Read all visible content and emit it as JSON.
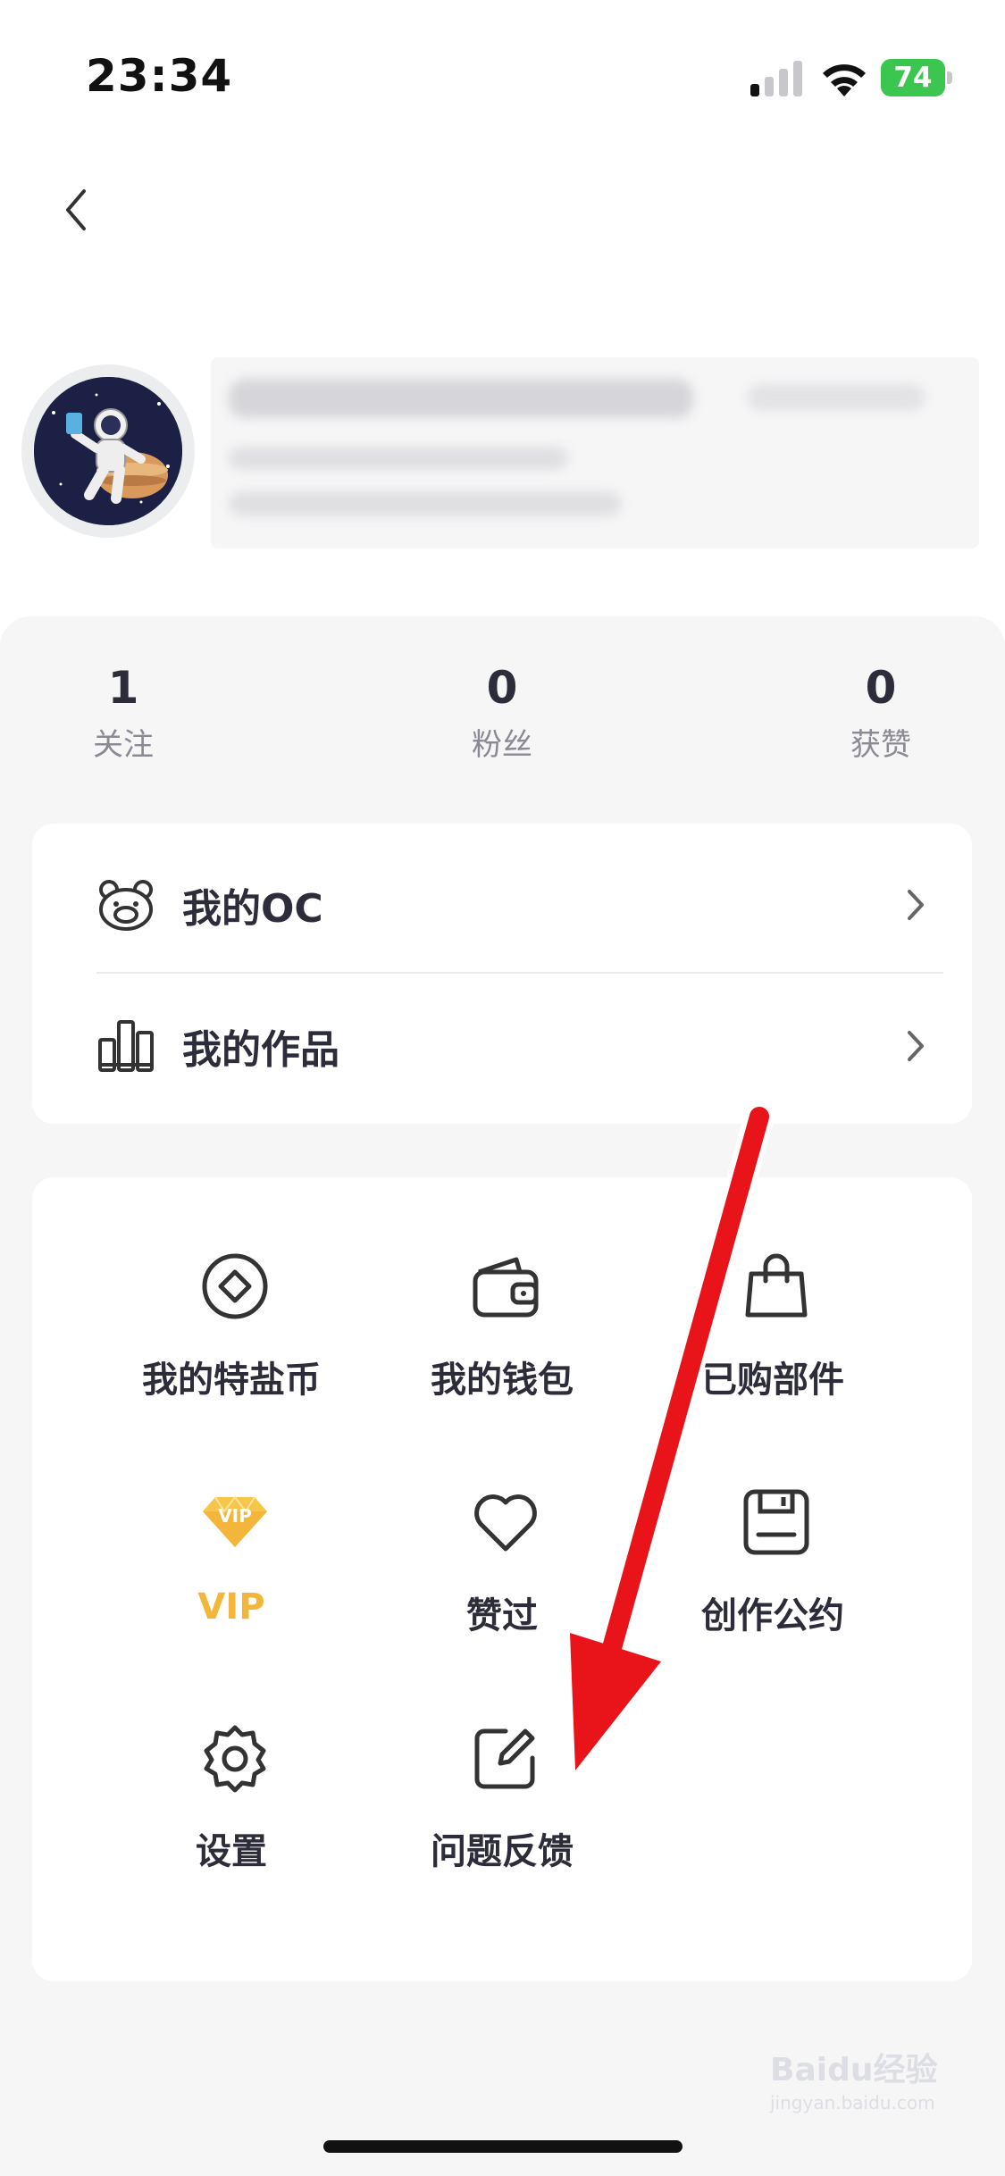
{
  "status_bar": {
    "time": "23:34",
    "battery": "74"
  },
  "stats": [
    {
      "value": "1",
      "label": "关注"
    },
    {
      "value": "0",
      "label": "粉丝"
    },
    {
      "value": "0",
      "label": "获赞"
    }
  ],
  "menu_rows": [
    {
      "label": "我的OC",
      "icon": "bear-face-icon"
    },
    {
      "label": "我的作品",
      "icon": "works-bars-icon"
    }
  ],
  "grid_items": [
    {
      "label": "我的特盐币",
      "icon": "coin-icon"
    },
    {
      "label": "我的钱包",
      "icon": "wallet-icon"
    },
    {
      "label": "已购部件",
      "icon": "shopping-bag-icon"
    },
    {
      "label": "VIP",
      "icon": "vip-diamond-icon",
      "badge_text": "VIP"
    },
    {
      "label": "赞过",
      "icon": "heart-icon"
    },
    {
      "label": "创作公约",
      "icon": "save-disk-icon"
    },
    {
      "label": "设置",
      "icon": "gear-icon"
    },
    {
      "label": "问题反馈",
      "icon": "edit-feedback-icon"
    }
  ],
  "watermark": {
    "brand": "Baidu经验",
    "url": "jingyan.baidu.com"
  },
  "colors": {
    "text_primary": "#2c2c3a",
    "text_secondary": "#8a8a94",
    "panel_bg": "#f6f6f6",
    "vip_gold": "#f3b53a",
    "battery_green": "#3ac64f",
    "annotation_red": "#e8141a"
  }
}
